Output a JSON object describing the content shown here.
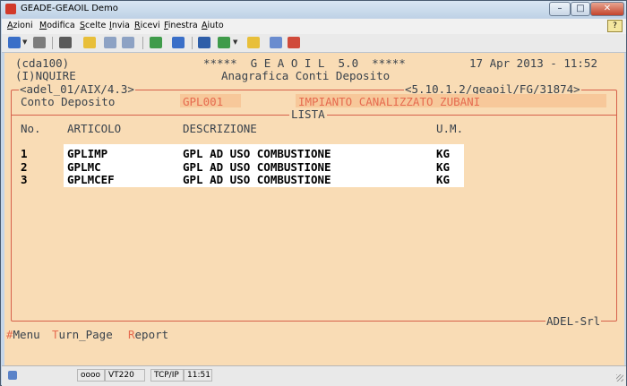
{
  "window": {
    "title": "GEADE-GEAOIL Demo"
  },
  "window_controls": {
    "minimize": "–",
    "maximize": "□",
    "close": "✕"
  },
  "menu": {
    "items": [
      {
        "u": "A",
        "rest": "zioni"
      },
      {
        "u": "M",
        "rest": "odifica"
      },
      {
        "u": "S",
        "rest": "celte"
      },
      {
        "u": "I",
        "rest": "nvia"
      },
      {
        "u": "R",
        "rest": "icevi"
      },
      {
        "u": "F",
        "rest": "inestra"
      },
      {
        "u": "A",
        "rest": "iuto"
      }
    ],
    "help_glyph": "?"
  },
  "toolbar": {
    "buttons": [
      "connect-icon",
      "disconnect-icon",
      "print-icon",
      "open-folder-icon",
      "copy-icon",
      "paste-icon",
      "keyboard-icon",
      "transfer-icon",
      "book-icon",
      "recycle-icon",
      "edit-icon",
      "notes-icon",
      "screen-icon"
    ],
    "colors": {
      "blue": "#3a6fc8",
      "yellow": "#e8bf3a",
      "red": "#d04a3a",
      "green": "#3f9b4a",
      "gray": "#7c7c7c"
    }
  },
  "terminal": {
    "header": {
      "program": "(cda100)",
      "product": "*****  G E A O I L  5.0  *****",
      "date_time": "17 Apr 2013 - 11:52",
      "mode": "(I)NQUIRE",
      "screen_title": "Anagrafica Conti Deposito",
      "frame_left": "<adel_01/AIX/4.3>",
      "frame_right": "<5.10.1.2/geaoil/FG/31874>"
    },
    "conto": {
      "label": "Conto Deposito",
      "code": "GPL001",
      "name": "IMPIANTO CANALIZZATO ZUBANI"
    },
    "lista_label": "LISTA",
    "columns": {
      "no": "No.",
      "articolo": "ARTICOLO",
      "descrizione": "DESCRIZIONE",
      "um": "U.M."
    },
    "rows": [
      {
        "no": "1",
        "articolo": "GPLIMP",
        "descrizione": "GPL AD USO COMBUSTIONE",
        "um": "KG"
      },
      {
        "no": "2",
        "articolo": "GPLMC",
        "descrizione": "GPL AD USO COMBUSTIONE",
        "um": "KG"
      },
      {
        "no": "3",
        "articolo": "GPLMCEF",
        "descrizione": "GPL AD USO COMBUSTIONE",
        "um": "KG"
      }
    ],
    "footer_brand": "ADEL-Srl",
    "commands": [
      {
        "hot": "#",
        "rest": "Menu"
      },
      {
        "hot": "T",
        "rest": "urn_Page"
      },
      {
        "hot": "R",
        "rest": "eport"
      }
    ],
    "colors": {
      "background": "#f9dcb5",
      "frame": "#d6604a",
      "highlight": "#e66b4f",
      "field": "#f7c89a"
    }
  },
  "status": {
    "state": "oooo",
    "emulation": "VT220",
    "protocol": "TCP/IP",
    "clock": "11:51"
  }
}
